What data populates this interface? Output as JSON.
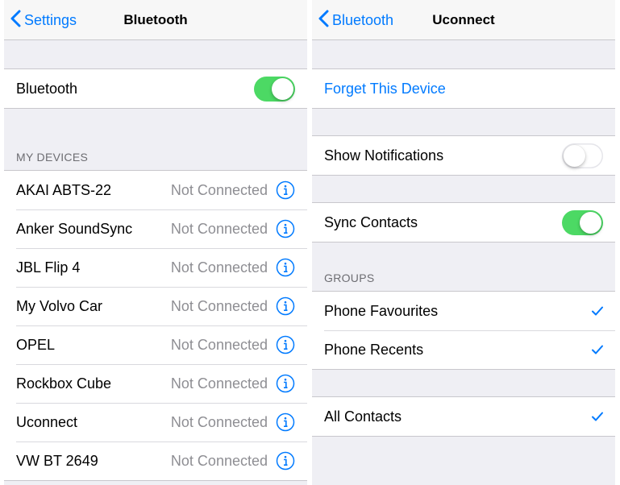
{
  "left": {
    "nav": {
      "back_label": "Settings",
      "title": "Bluetooth"
    },
    "bluetooth_row": {
      "label": "Bluetooth",
      "toggle_on": true
    },
    "my_devices_header": "MY DEVICES",
    "devices": [
      {
        "name": "AKAI ABTS-22",
        "status": "Not Connected"
      },
      {
        "name": "Anker SoundSync",
        "status": "Not Connected"
      },
      {
        "name": "JBL Flip 4",
        "status": "Not Connected"
      },
      {
        "name": "My Volvo Car",
        "status": "Not Connected"
      },
      {
        "name": "OPEL",
        "status": "Not Connected"
      },
      {
        "name": "Rockbox Cube",
        "status": "Not Connected"
      },
      {
        "name": "Uconnect",
        "status": "Not Connected"
      },
      {
        "name": "VW BT 2649",
        "status": "Not Connected"
      }
    ]
  },
  "right": {
    "nav": {
      "back_label": "Bluetooth",
      "title": "Uconnect"
    },
    "forget_label": "Forget This Device",
    "show_notifications": {
      "label": "Show Notifications",
      "toggle_on": false
    },
    "sync_contacts": {
      "label": "Sync Contacts",
      "toggle_on": true
    },
    "groups_header": "GROUPS",
    "groups": [
      {
        "label": "Phone Favourites",
        "checked": true
      },
      {
        "label": "Phone Recents",
        "checked": true
      }
    ],
    "all_contacts": {
      "label": "All Contacts",
      "checked": true
    }
  },
  "colors": {
    "accent": "#007aff",
    "toggle_on": "#4cd964",
    "grouped_background": "#efeff4",
    "secondary_text": "#8e8e93"
  },
  "icons": {
    "back": "chevron-left-icon",
    "info": "info-circle-icon",
    "check": "checkmark-icon"
  }
}
